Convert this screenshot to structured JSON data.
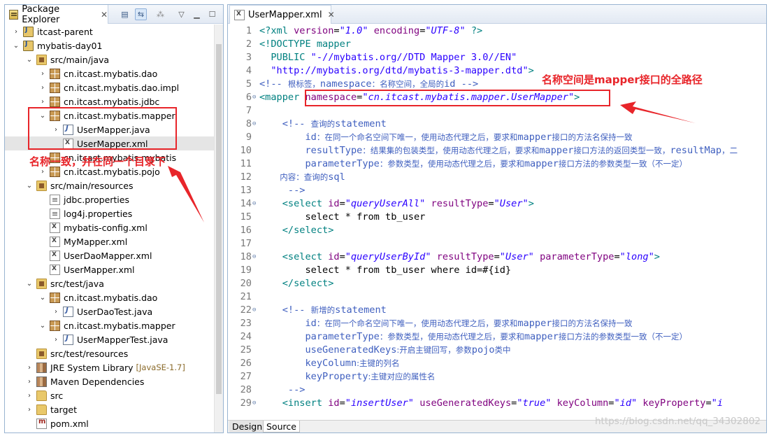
{
  "package_explorer": {
    "title": "Package Explorer",
    "close": "✕",
    "toolbar_icons": [
      "collapse-all-icon",
      "link-with-editor-icon",
      "focus-icon",
      "view-menu-icon",
      "minimize-icon",
      "maximize-icon"
    ],
    "tree": [
      {
        "label": "itcast-parent",
        "icon": "project-icon",
        "chevron": "›",
        "depth": 0
      },
      {
        "label": "mybatis-day01",
        "icon": "project-icon",
        "chevron": "⌄",
        "depth": 0
      },
      {
        "label": "src/main/java",
        "icon": "source-folder-icon",
        "chevron": "⌄",
        "depth": 1
      },
      {
        "label": "cn.itcast.mybatis.dao",
        "icon": "package-icon",
        "chevron": "›",
        "depth": 2
      },
      {
        "label": "cn.itcast.mybatis.dao.impl",
        "icon": "package-icon",
        "chevron": "›",
        "depth": 2
      },
      {
        "label": "cn.itcast.mybatis.jdbc",
        "icon": "package-icon",
        "chevron": "›",
        "depth": 2
      },
      {
        "label": "cn.itcast.mybatis.mapper",
        "icon": "package-icon",
        "chevron": "⌄",
        "depth": 2
      },
      {
        "label": "UserMapper.java",
        "icon": "java-file-icon",
        "chevron": "›",
        "depth": 3
      },
      {
        "label": "UserMapper.xml",
        "icon": "xml-file-icon",
        "chevron": "",
        "depth": 3,
        "selected": true
      },
      {
        "label": "cn.itcast.mybatis.mybatis",
        "icon": "package-icon",
        "chevron": "›",
        "depth": 2
      },
      {
        "label": "cn.itcast.mybatis.pojo",
        "icon": "package-icon",
        "chevron": "›",
        "depth": 2
      },
      {
        "label": "src/main/resources",
        "icon": "source-folder-icon",
        "chevron": "⌄",
        "depth": 1
      },
      {
        "label": "jdbc.properties",
        "icon": "properties-file-icon",
        "chevron": "",
        "depth": 2
      },
      {
        "label": "log4j.properties",
        "icon": "properties-file-icon",
        "chevron": "",
        "depth": 2
      },
      {
        "label": "mybatis-config.xml",
        "icon": "xml-file-icon",
        "chevron": "",
        "depth": 2
      },
      {
        "label": "MyMapper.xml",
        "icon": "xml-file-icon",
        "chevron": "",
        "depth": 2
      },
      {
        "label": "UserDaoMapper.xml",
        "icon": "xml-file-icon",
        "chevron": "",
        "depth": 2
      },
      {
        "label": "UserMapper.xml",
        "icon": "xml-file-icon",
        "chevron": "",
        "depth": 2
      },
      {
        "label": "src/test/java",
        "icon": "source-folder-icon",
        "chevron": "⌄",
        "depth": 1
      },
      {
        "label": "cn.itcast.mybatis.dao",
        "icon": "package-icon",
        "chevron": "⌄",
        "depth": 2
      },
      {
        "label": "UserDaoTest.java",
        "icon": "java-file-icon",
        "chevron": "›",
        "depth": 3
      },
      {
        "label": "cn.itcast.mybatis.mapper",
        "icon": "package-icon",
        "chevron": "⌄",
        "depth": 2
      },
      {
        "label": "UserMapperTest.java",
        "icon": "java-file-icon",
        "chevron": "›",
        "depth": 3
      },
      {
        "label": "src/test/resources",
        "icon": "source-folder-icon",
        "chevron": "",
        "depth": 1
      },
      {
        "label": "JRE System Library",
        "icon": "library-icon",
        "chevron": "›",
        "depth": 1,
        "decoration": "[JavaSE-1.7]"
      },
      {
        "label": "Maven Dependencies",
        "icon": "library-icon",
        "chevron": "›",
        "depth": 1
      },
      {
        "label": "src",
        "icon": "folder-icon",
        "chevron": "›",
        "depth": 1
      },
      {
        "label": "target",
        "icon": "folder-icon",
        "chevron": "›",
        "depth": 1
      },
      {
        "label": "pom.xml",
        "icon": "pom-file-icon",
        "chevron": "",
        "depth": 1
      }
    ]
  },
  "editor": {
    "tab_label": "UserMapper.xml",
    "close": "✕",
    "bottom_tabs": {
      "design": "Design",
      "source": "Source"
    },
    "lines": [
      {
        "n": "1",
        "fold": "",
        "segs": [
          {
            "c": "pi",
            "t": "<?xml "
          },
          {
            "c": "attr",
            "t": "version"
          },
          {
            "c": "plain",
            "t": "="
          },
          {
            "c": "str",
            "t": "\"1.0\""
          },
          {
            "c": "plain",
            "t": " "
          },
          {
            "c": "attr",
            "t": "encoding"
          },
          {
            "c": "plain",
            "t": "="
          },
          {
            "c": "str",
            "t": "\"UTF-8\""
          },
          {
            "c": "pi",
            "t": " ?>"
          }
        ]
      },
      {
        "n": "2",
        "fold": "",
        "segs": [
          {
            "c": "doc",
            "t": "<!DOCTYPE mapper"
          }
        ]
      },
      {
        "n": "3",
        "fold": "",
        "segs": [
          {
            "c": "doc",
            "t": "  PUBLIC "
          },
          {
            "c": "docstr",
            "t": "\"-//mybatis.org//DTD Mapper 3.0//EN\""
          }
        ]
      },
      {
        "n": "4",
        "fold": "",
        "segs": [
          {
            "c": "docstr",
            "t": "  \"http://mybatis.org/dtd/mybatis-3-mapper.dtd\""
          },
          {
            "c": "doc",
            "t": ">"
          }
        ]
      },
      {
        "n": "5",
        "fold": "",
        "segs": [
          {
            "c": "com",
            "t": "<!-- "
          },
          {
            "c": "cjk",
            "t": "根标签，"
          },
          {
            "c": "com",
            "t": "namespace"
          },
          {
            "c": "cjk",
            "t": "：名称空间，全局的"
          },
          {
            "c": "com",
            "t": "id -->"
          }
        ]
      },
      {
        "n": "6",
        "fold": "⊖",
        "segs": [
          {
            "c": "tag",
            "t": "<mapper "
          },
          {
            "c": "attr",
            "t": "namespace"
          },
          {
            "c": "plain",
            "t": "="
          },
          {
            "c": "str",
            "t": "\"cn.itcast.mybatis.mapper.UserMapper\""
          },
          {
            "c": "tag",
            "t": ">"
          }
        ]
      },
      {
        "n": "7",
        "fold": "",
        "segs": []
      },
      {
        "n": "8",
        "fold": "⊖",
        "segs": [
          {
            "c": "com",
            "t": "    <!-- "
          },
          {
            "c": "cjk",
            "t": "查询的"
          },
          {
            "c": "com",
            "t": "statement"
          }
        ]
      },
      {
        "n": "9",
        "fold": "",
        "segs": [
          {
            "c": "com",
            "t": "        id"
          },
          {
            "c": "cjk",
            "t": "：在同一个命名空间下唯一，使用动态代理之后，要求和"
          },
          {
            "c": "com",
            "t": "mapper"
          },
          {
            "c": "cjk",
            "t": "接口的方法名保持一致"
          }
        ]
      },
      {
        "n": "10",
        "fold": "",
        "segs": [
          {
            "c": "com",
            "t": "        resultType"
          },
          {
            "c": "cjk",
            "t": "：结果集的包装类型，使用动态代理之后，要求和"
          },
          {
            "c": "com",
            "t": "mapper"
          },
          {
            "c": "cjk",
            "t": "接口方法的返回类型一致，"
          },
          {
            "c": "com",
            "t": "resultMap"
          },
          {
            "c": "cjk",
            "t": "，二"
          }
        ]
      },
      {
        "n": "11",
        "fold": "",
        "segs": [
          {
            "c": "com",
            "t": "        parameterType"
          },
          {
            "c": "cjk",
            "t": "：参数类型，使用动态代理之后，要求和"
          },
          {
            "c": "com",
            "t": "mapper"
          },
          {
            "c": "cjk",
            "t": "接口方法的参数类型一致（不一定）"
          }
        ]
      },
      {
        "n": "12",
        "fold": "",
        "segs": [
          {
            "c": "cjk",
            "t": "        内容：查询的"
          },
          {
            "c": "com",
            "t": "sql"
          }
        ]
      },
      {
        "n": "13",
        "fold": "",
        "segs": [
          {
            "c": "com",
            "t": "     -->"
          }
        ]
      },
      {
        "n": "14",
        "fold": "⊖",
        "segs": [
          {
            "c": "tag",
            "t": "    <select "
          },
          {
            "c": "attr",
            "t": "id"
          },
          {
            "c": "plain",
            "t": "="
          },
          {
            "c": "str",
            "t": "\"queryUserAll\""
          },
          {
            "c": "plain",
            "t": " "
          },
          {
            "c": "attr",
            "t": "resultType"
          },
          {
            "c": "plain",
            "t": "="
          },
          {
            "c": "str",
            "t": "\"User\""
          },
          {
            "c": "tag",
            "t": ">"
          }
        ]
      },
      {
        "n": "15",
        "fold": "",
        "segs": [
          {
            "c": "plain",
            "t": "        select * from tb_user"
          }
        ]
      },
      {
        "n": "16",
        "fold": "",
        "segs": [
          {
            "c": "tag",
            "t": "    </select>"
          }
        ]
      },
      {
        "n": "17",
        "fold": "",
        "segs": []
      },
      {
        "n": "18",
        "fold": "⊖",
        "segs": [
          {
            "c": "tag",
            "t": "    <select "
          },
          {
            "c": "attr",
            "t": "id"
          },
          {
            "c": "plain",
            "t": "="
          },
          {
            "c": "str",
            "t": "\"queryUserById\""
          },
          {
            "c": "plain",
            "t": " "
          },
          {
            "c": "attr",
            "t": "resultType"
          },
          {
            "c": "plain",
            "t": "="
          },
          {
            "c": "str",
            "t": "\"User\""
          },
          {
            "c": "plain",
            "t": " "
          },
          {
            "c": "attr",
            "t": "parameterType"
          },
          {
            "c": "plain",
            "t": "="
          },
          {
            "c": "str",
            "t": "\"long\""
          },
          {
            "c": "tag",
            "t": ">"
          }
        ]
      },
      {
        "n": "19",
        "fold": "",
        "segs": [
          {
            "c": "plain",
            "t": "        select * from tb_user where id=#{id}"
          }
        ]
      },
      {
        "n": "20",
        "fold": "",
        "segs": [
          {
            "c": "tag",
            "t": "    </select>"
          }
        ]
      },
      {
        "n": "21",
        "fold": "",
        "segs": []
      },
      {
        "n": "22",
        "fold": "⊖",
        "segs": [
          {
            "c": "com",
            "t": "    <!-- "
          },
          {
            "c": "cjk",
            "t": "新增的"
          },
          {
            "c": "com",
            "t": "statement"
          }
        ]
      },
      {
        "n": "23",
        "fold": "",
        "segs": [
          {
            "c": "com",
            "t": "        id"
          },
          {
            "c": "cjk",
            "t": "：在同一个命名空间下唯一，使用动态代理之后，要求和"
          },
          {
            "c": "com",
            "t": "mapper"
          },
          {
            "c": "cjk",
            "t": "接口的方法名保持一致"
          }
        ]
      },
      {
        "n": "24",
        "fold": "",
        "segs": [
          {
            "c": "com",
            "t": "        parameterType"
          },
          {
            "c": "cjk",
            "t": "：参数类型，使用动态代理之后，要求和"
          },
          {
            "c": "com",
            "t": "mapper"
          },
          {
            "c": "cjk",
            "t": "接口方法的参数类型一致（不一定）"
          }
        ]
      },
      {
        "n": "25",
        "fold": "",
        "segs": [
          {
            "c": "com",
            "t": "        useGeneratedKeys"
          },
          {
            "c": "cjk",
            "t": ":开启主键回写，参数"
          },
          {
            "c": "com",
            "t": "pojo"
          },
          {
            "c": "cjk",
            "t": "类中"
          }
        ]
      },
      {
        "n": "26",
        "fold": "",
        "segs": [
          {
            "c": "com",
            "t": "        keyColumn"
          },
          {
            "c": "cjk",
            "t": ":主键的列名"
          }
        ]
      },
      {
        "n": "27",
        "fold": "",
        "segs": [
          {
            "c": "com",
            "t": "        keyProperty"
          },
          {
            "c": "cjk",
            "t": ":主键对应的属性名"
          }
        ]
      },
      {
        "n": "28",
        "fold": "",
        "segs": [
          {
            "c": "com",
            "t": "     -->"
          }
        ]
      },
      {
        "n": "29",
        "fold": "⊖",
        "segs": [
          {
            "c": "tag",
            "t": "    <insert "
          },
          {
            "c": "attr",
            "t": "id"
          },
          {
            "c": "plain",
            "t": "="
          },
          {
            "c": "str",
            "t": "\"insertUser\""
          },
          {
            "c": "plain",
            "t": " "
          },
          {
            "c": "attr",
            "t": "useGeneratedKeys"
          },
          {
            "c": "plain",
            "t": "="
          },
          {
            "c": "str",
            "t": "\"true\""
          },
          {
            "c": "plain",
            "t": " "
          },
          {
            "c": "attr",
            "t": "keyColumn"
          },
          {
            "c": "plain",
            "t": "="
          },
          {
            "c": "str",
            "t": "\"id\""
          },
          {
            "c": "plain",
            "t": " "
          },
          {
            "c": "attr",
            "t": "keyProperty"
          },
          {
            "c": "plain",
            "t": "="
          },
          {
            "c": "str",
            "t": "\"i"
          }
        ]
      }
    ]
  },
  "annotations": {
    "namespace_note": "名称空间是mapper接口的全路径",
    "same_dir_note": "名称一致，并在同一个目录下",
    "accent_color": "#e8252a"
  },
  "watermark": "https://blog.csdn.net/qq_34302802"
}
